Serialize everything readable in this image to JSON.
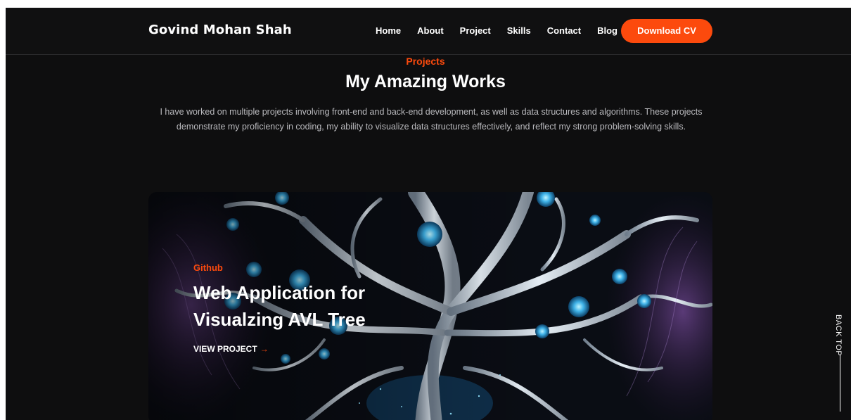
{
  "header": {
    "logo": "Govind Mohan Shah",
    "nav": [
      "Home",
      "About",
      "Project",
      "Skills",
      "Contact",
      "Blog"
    ],
    "cta_label": "Download CV"
  },
  "projects_section": {
    "eyebrow": "Projects",
    "title": "My Amazing Works",
    "description": "I have worked on multiple projects involving front-end and back-end development, as well as data structures and algorithms. These projects demonstrate my proficiency in coding, my ability to visualize data structures effectively, and reflect my strong problem-solving skills."
  },
  "project_card": {
    "tag": "Github",
    "title": "Web Application for Visualzing AVL Tree",
    "link_label": "VIEW PROJECT",
    "link_icon": "arrow-right-icon"
  },
  "back_to_top": {
    "label": "BACK TOP"
  },
  "colors": {
    "accent": "#fc4a0d",
    "background": "#0e0e0f",
    "header_background": "#101011",
    "text_primary": "#ffffff",
    "text_muted": "#b9b9bd"
  }
}
